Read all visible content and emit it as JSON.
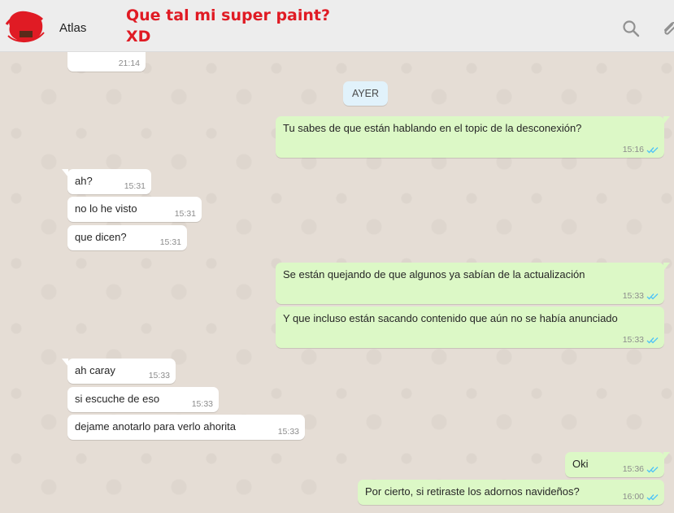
{
  "header": {
    "contact_name": "Atlas",
    "annotation": "Que tal mi super paint?\nXD",
    "icons": [
      "search-icon",
      "attach-icon"
    ],
    "annotation_color": "#e01b24"
  },
  "chat": {
    "date_divider": "AYER",
    "top_partial_time": "21:14",
    "messages": [
      {
        "dir": "out",
        "text": "Tu sabes de que están hablando en el topic de la desconexión?",
        "time": "15:16",
        "status": "read"
      },
      {
        "dir": "in",
        "text": "ah?",
        "time": "15:31"
      },
      {
        "dir": "in",
        "text": "no lo he visto",
        "time": "15:31"
      },
      {
        "dir": "in",
        "text": "que dicen?",
        "time": "15:31"
      },
      {
        "dir": "out",
        "text": "Se están quejando de que algunos ya sabían de la actualización",
        "time": "15:33",
        "status": "read"
      },
      {
        "dir": "out",
        "text": "Y que incluso están sacando contenido que aún no se había anunciado",
        "time": "15:33",
        "status": "read"
      },
      {
        "dir": "in",
        "text": "ah caray",
        "time": "15:33"
      },
      {
        "dir": "in",
        "text": "si escuche de eso",
        "time": "15:33"
      },
      {
        "dir": "in",
        "text": "dejame anotarlo para verlo ahorita",
        "time": "15:33"
      },
      {
        "dir": "out",
        "text": "Oki",
        "time": "15:36",
        "status": "read"
      },
      {
        "dir": "out",
        "text": "Por cierto, si retiraste los adornos navideños?",
        "time": "16:00",
        "status": "read"
      }
    ]
  },
  "colors": {
    "outgoing_bubble": "#dcf8c6",
    "incoming_bubble": "#ffffff",
    "read_tick": "#4fc3f7",
    "chat_background": "#e5ddd5"
  }
}
